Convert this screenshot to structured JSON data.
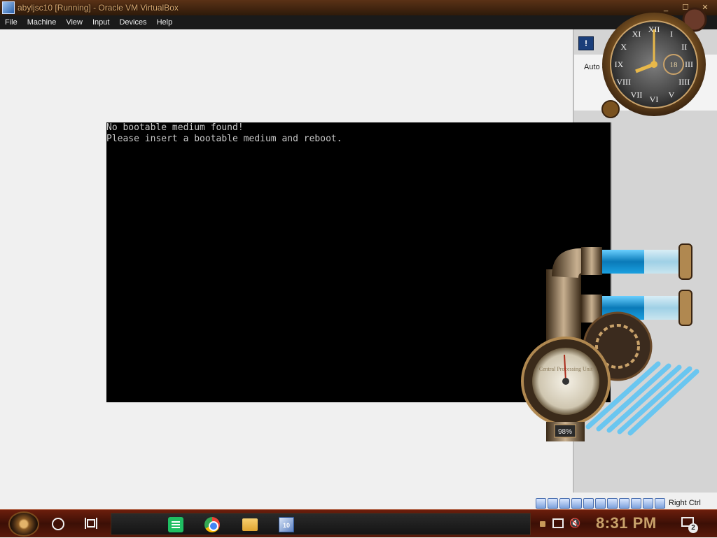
{
  "window": {
    "title": "abyljsc10 [Running] - Oracle VM VirtualBox",
    "caption_buttons": [
      "_",
      "☐",
      "✕"
    ]
  },
  "menubar": {
    "items": [
      "File",
      "Machine",
      "View",
      "Input",
      "Devices",
      "Help"
    ]
  },
  "vm_screen": {
    "lines": [
      "No bootable medium found!",
      "Please insert a bootable medium and reboot."
    ]
  },
  "side_panel": {
    "text": "Auto capture"
  },
  "gadgets": {
    "clock": {
      "numerals": [
        "XII",
        "I",
        "II",
        "III",
        "IIII",
        "V",
        "VI",
        "VII",
        "VIII",
        "IX",
        "X",
        "XI"
      ],
      "date": "18"
    },
    "pipes": {
      "gauge_label": "Central Processing Unit",
      "percent": "98%"
    }
  },
  "statusbar": {
    "host_key_label": "Right Ctrl"
  },
  "taskbar": {
    "time": "8:31 PM",
    "notification_count": "2",
    "vbox_badge": "10"
  }
}
